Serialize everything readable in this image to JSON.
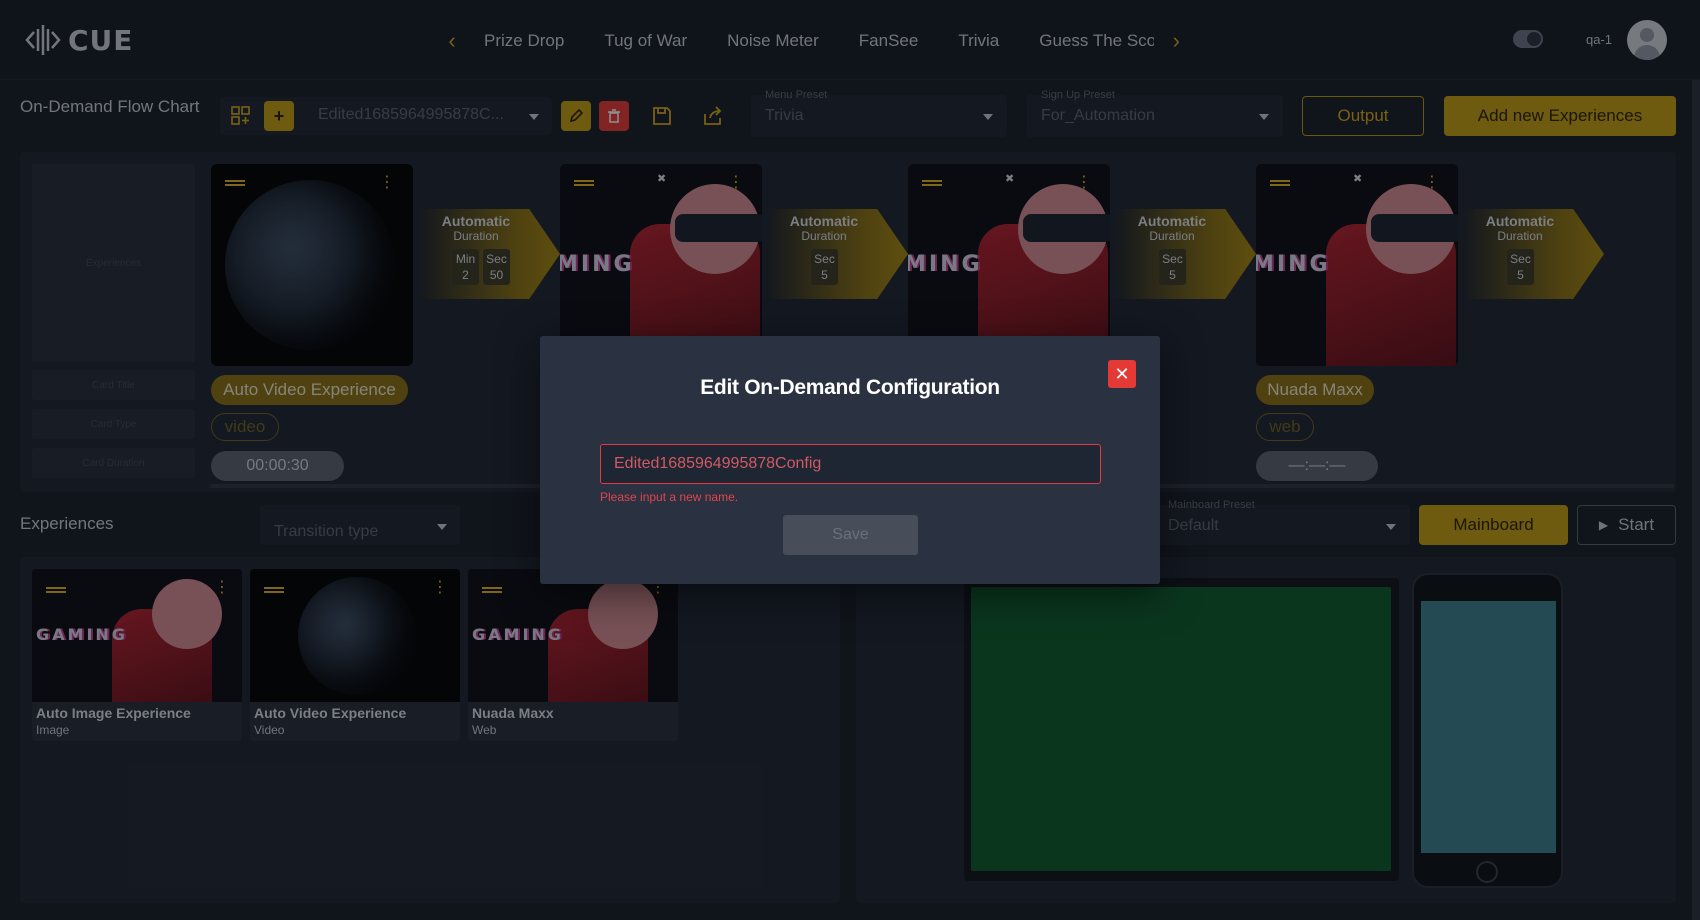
{
  "app": {
    "logo": "CUE"
  },
  "nav": {
    "tabs": [
      "Prize Drop",
      "Tug of War",
      "Noise Meter",
      "FanSee",
      "Trivia",
      "Guess The Sco"
    ],
    "prev_icon": "chevron-left-icon",
    "next_icon": "chevron-right-icon"
  },
  "user": {
    "name": "qa-1"
  },
  "toolbar": {
    "title": "On-Demand Flow Chart",
    "config_name": "Edited1685964995878C...",
    "menu_preset": {
      "label": "Menu Preset",
      "value": "Trivia"
    },
    "signup_preset": {
      "label": "Sign Up Preset",
      "value": "For_Automation"
    },
    "output_label": "Output",
    "add_label": "Add new Experiences"
  },
  "placeholders": {
    "experiences": "Experiences",
    "card_title": "Card Title",
    "card_type": "Card Type",
    "card_duration": "Card Duration"
  },
  "flow": {
    "arrows": [
      {
        "title": "Automatic",
        "sub": "Duration",
        "boxes": [
          {
            "label": "Min",
            "value": "2"
          },
          {
            "label": "Sec",
            "value": "50"
          }
        ]
      },
      {
        "title": "Automatic",
        "sub": "Duration",
        "boxes": [
          {
            "label": "Sec",
            "value": "5"
          }
        ]
      },
      {
        "title": "Automatic",
        "sub": "Duration",
        "boxes": [
          {
            "label": "Sec",
            "value": "5"
          }
        ]
      },
      {
        "title": "Automatic",
        "sub": "Duration",
        "boxes": [
          {
            "label": "Sec",
            "value": "5"
          }
        ]
      }
    ],
    "first_card": {
      "title": "Auto Video Experience",
      "type": "video",
      "duration": "00:00:30"
    },
    "last_card": {
      "title": "Nuada Maxx",
      "type": "web",
      "duration": "—:—:—"
    },
    "gaming_word": "MING"
  },
  "experiences": {
    "title": "Experiences",
    "transition_placeholder": "Transition type",
    "items": [
      {
        "name": "Auto Image Experience",
        "type": "Image",
        "word": "GAMING"
      },
      {
        "name": "Auto Video Experience",
        "type": "Video"
      },
      {
        "name": "Nuada Maxx",
        "type": "Web",
        "word": "GAMING"
      }
    ]
  },
  "mainboard": {
    "preset_label": "Mainboard Preset",
    "preset_value": "Default",
    "mainboard_label": "Mainboard",
    "start_label": "Start",
    "start_icon": "play-icon"
  },
  "modal": {
    "title": "Edit On-Demand Configuration",
    "input_value": "Edited1685964995878Config",
    "error": "Please input a new name.",
    "save_label": "Save",
    "close_icon": "close-icon"
  },
  "colors": {
    "accent": "#c49d10",
    "error": "#e53935",
    "background": "#161c26",
    "panel": "#1d2430"
  }
}
